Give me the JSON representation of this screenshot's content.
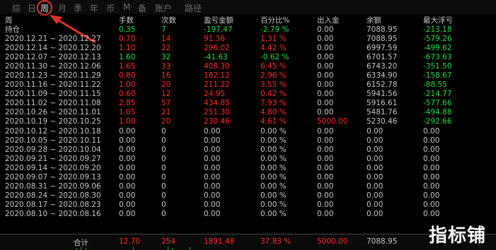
{
  "tabs": [
    "综",
    "日",
    "周",
    "月",
    "季",
    "年",
    "币",
    "M",
    "备",
    "账户",
    "路径"
  ],
  "active_tab_index": 2,
  "headers": {
    "period": "周",
    "lots": "手数",
    "count": "次数",
    "pnl": "盈亏金额",
    "percent": "百分比%",
    "deposit": "出入金",
    "balance": "余额",
    "max_float_loss": "最大浮亏"
  },
  "position_row": {
    "label": "持仓",
    "lots": "0.35",
    "count": "7",
    "pnl": "-197.47",
    "percent": "-2.79 %",
    "deposit": "0.00",
    "balance": "7088.95",
    "max_float_loss": "-213.18"
  },
  "rows": [
    {
      "period": "2020.12.21 ~ 2020.12.27",
      "lots": "0.70",
      "count": "14",
      "pnl": "91.36",
      "percent": "1.31 %",
      "deposit": "0.00",
      "balance": "7088.95",
      "max_float_loss": "-579.26",
      "tone": "red"
    },
    {
      "period": "2020.12.14 ~ 2020.12.20",
      "lots": "1.10",
      "count": "22",
      "pnl": "296.02",
      "percent": "4.42 %",
      "deposit": "0.00",
      "balance": "6997.59",
      "max_float_loss": "-499.62",
      "tone": "red"
    },
    {
      "period": "2020.12.07 ~ 2020.12.13",
      "lots": "1.60",
      "count": "32",
      "pnl": "-41.63",
      "percent": "-0.62 %",
      "deposit": "0.00",
      "balance": "6701.57",
      "max_float_loss": "-673.63",
      "tone": "green"
    },
    {
      "period": "2020.11.30 ~ 2020.12.06",
      "lots": "1.65",
      "count": "33",
      "pnl": "408.30",
      "percent": "6.45 %",
      "deposit": "0.00",
      "balance": "6743.20",
      "max_float_loss": "-351.50",
      "tone": "red"
    },
    {
      "period": "2020.11.23 ~ 2020.11.29",
      "lots": "0.80",
      "count": "16",
      "pnl": "182.12",
      "percent": "2.96 %",
      "deposit": "0.00",
      "balance": "6334.90",
      "max_float_loss": "-158.67",
      "tone": "red"
    },
    {
      "period": "2020.11.16 ~ 2020.11.22",
      "lots": "1.00",
      "count": "20",
      "pnl": "211.22",
      "percent": "3.55 %",
      "deposit": "0.00",
      "balance": "6152.78",
      "max_float_loss": "-88.55",
      "tone": "red"
    },
    {
      "period": "2020.11.09 ~ 2020.11.15",
      "lots": "0.60",
      "count": "12",
      "pnl": "24.95",
      "percent": "0.42 %",
      "deposit": "0.00",
      "balance": "5941.56",
      "max_float_loss": "-214.77",
      "tone": "red"
    },
    {
      "period": "2020.11.02 ~ 2020.11.08",
      "lots": "2.85",
      "count": "57",
      "pnl": "434.85",
      "percent": "7.93 %",
      "deposit": "0.00",
      "balance": "5916.61",
      "max_float_loss": "-577.66",
      "tone": "red"
    },
    {
      "period": "2020.10.26 ~ 2020.11.01",
      "lots": "1.05",
      "count": "21",
      "pnl": "251.30",
      "percent": "4.80 %",
      "deposit": "0.00",
      "balance": "5481.76",
      "max_float_loss": "-494.88",
      "tone": "red"
    },
    {
      "period": "2020.10.19 ~ 2020.10.25",
      "lots": "1.00",
      "count": "20",
      "pnl": "230.46",
      "percent": "4.61 %",
      "deposit": "5000.00",
      "balance": "5230.46",
      "max_float_loss": "-292.66",
      "tone": "red"
    },
    {
      "period": "2020.10.12 ~ 2020.10.18",
      "lots": "0.00",
      "count": "0",
      "pnl": "0.00",
      "percent": "0.00 %",
      "deposit": "0.00",
      "balance": "0.00",
      "max_float_loss": "0.00",
      "tone": "gray"
    },
    {
      "period": "2020.10.05 ~ 2020.10.11",
      "lots": "0.00",
      "count": "0",
      "pnl": "0.00",
      "percent": "0.00 %",
      "deposit": "0.00",
      "balance": "0.00",
      "max_float_loss": "0.00",
      "tone": "gray"
    },
    {
      "period": "2020.09.28 ~ 2020.10.04",
      "lots": "0.00",
      "count": "0",
      "pnl": "0.00",
      "percent": "0.00 %",
      "deposit": "0.00",
      "balance": "0.00",
      "max_float_loss": "0.00",
      "tone": "gray"
    },
    {
      "period": "2020.09.21 ~ 2020.09.27",
      "lots": "0.00",
      "count": "0",
      "pnl": "0.00",
      "percent": "0.00 %",
      "deposit": "0.00",
      "balance": "0.00",
      "max_float_loss": "0.00",
      "tone": "gray"
    },
    {
      "period": "2020.09.14 ~ 2020.09.20",
      "lots": "0.00",
      "count": "0",
      "pnl": "0.00",
      "percent": "0.00 %",
      "deposit": "0.00",
      "balance": "0.00",
      "max_float_loss": "0.00",
      "tone": "gray"
    },
    {
      "period": "2020.09.07 ~ 2020.09.13",
      "lots": "0.00",
      "count": "0",
      "pnl": "0.00",
      "percent": "0.00 %",
      "deposit": "0.00",
      "balance": "0.00",
      "max_float_loss": "0.00",
      "tone": "gray"
    },
    {
      "period": "2020.08.31 ~ 2020.09.06",
      "lots": "0.00",
      "count": "0",
      "pnl": "0.00",
      "percent": "0.00 %",
      "deposit": "0.00",
      "balance": "0.00",
      "max_float_loss": "0.00",
      "tone": "gray"
    },
    {
      "period": "2020.08.24 ~ 2020.08.30",
      "lots": "0.00",
      "count": "0",
      "pnl": "0.00",
      "percent": "0.00 %",
      "deposit": "0.00",
      "balance": "0.00",
      "max_float_loss": "0.00",
      "tone": "gray"
    },
    {
      "period": "2020.08.17 ~ 2020.08.23",
      "lots": "0.00",
      "count": "0",
      "pnl": "0.00",
      "percent": "0.00 %",
      "deposit": "0.00",
      "balance": "0.00",
      "max_float_loss": "0.00",
      "tone": "gray"
    },
    {
      "period": "2020.08.10 ~ 2020.08.16",
      "lots": "0.00",
      "count": "0",
      "pnl": "0.00",
      "percent": "0.00 %",
      "deposit": "0.00",
      "balance": "0.00",
      "max_float_loss": "0.00",
      "tone": "gray"
    }
  ],
  "totals": {
    "label": "合计",
    "lots": "12.70",
    "count": "254",
    "pnl": "1891.48",
    "percent": "37.83 %",
    "deposit": "5000.00",
    "balance": "7088.95"
  },
  "watermark": "指标铺",
  "colors": {
    "background": "#000000",
    "profit": "#ff2a2a",
    "loss": "#22dd44",
    "neutral": "#c8c8c8",
    "annotation": "#e0332a"
  }
}
